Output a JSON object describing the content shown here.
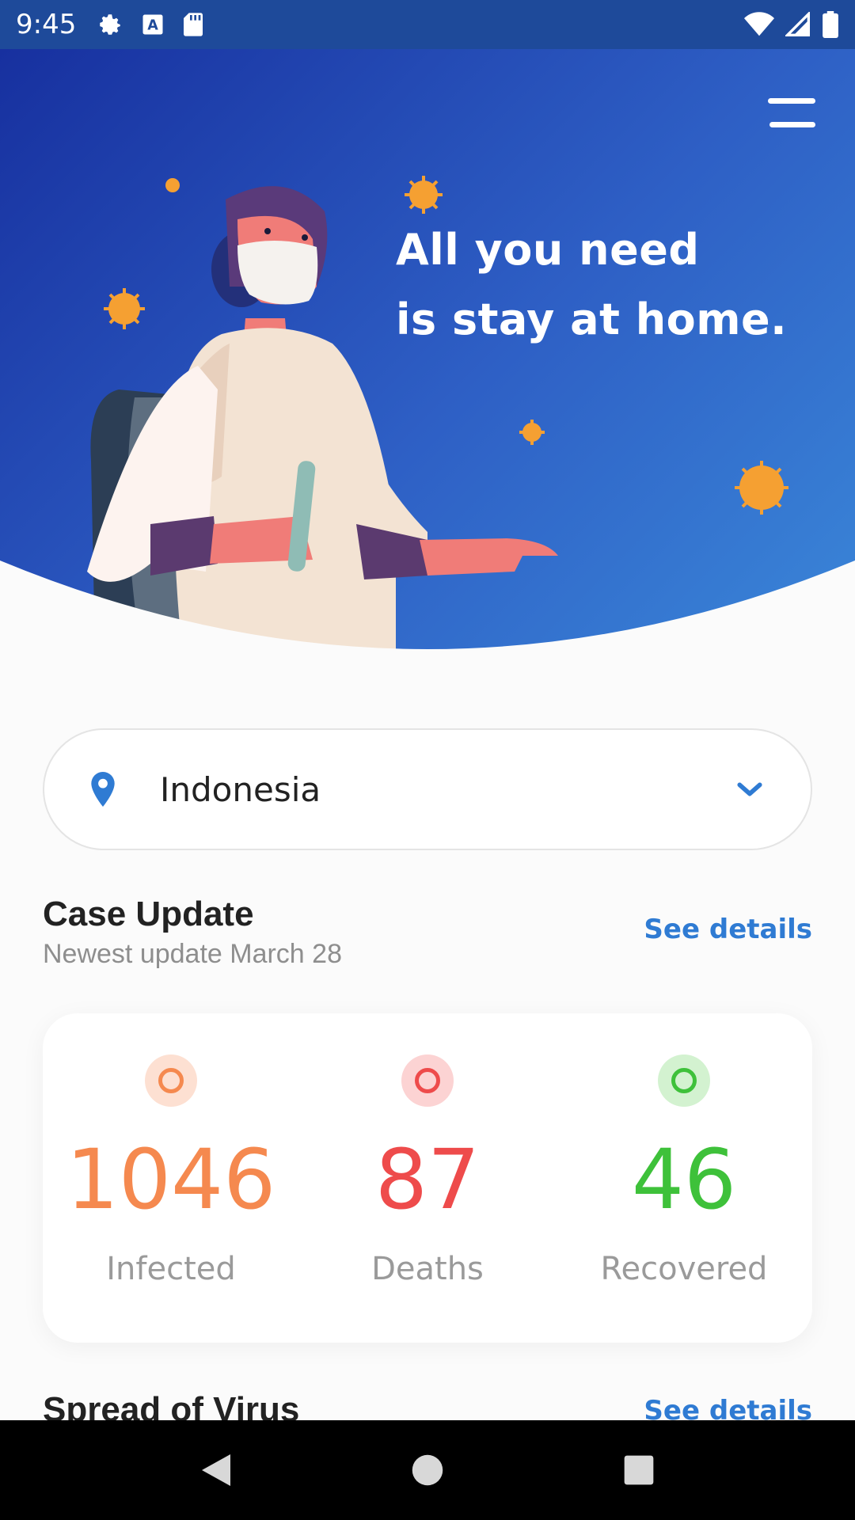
{
  "status_bar": {
    "time": "9:45",
    "left_icons": [
      "gear-icon",
      "text-a-icon",
      "sd-card-icon"
    ],
    "right_icons": [
      "wifi-icon",
      "signal-icon",
      "battery-icon"
    ]
  },
  "hero": {
    "title_line1": "All you need",
    "title_line2": "is stay at home.",
    "colors": {
      "gradient_start": "#17309f",
      "gradient_end": "#3a86d8"
    }
  },
  "country_select": {
    "value": "Indonesia",
    "icon": "location-pin-icon",
    "dropdown_icon": "chevron-down-icon"
  },
  "case_update": {
    "title": "Case Update",
    "subtitle": "Newest update March 28",
    "link": "See details"
  },
  "stats": [
    {
      "value": "1046",
      "label": "Infected",
      "color": "#f5894f"
    },
    {
      "value": "87",
      "label": "Deaths",
      "color": "#ee4b4b"
    },
    {
      "value": "46",
      "label": "Recovered",
      "color": "#3ec13a"
    }
  ],
  "spread": {
    "title": "Spread of Virus",
    "link": "See details"
  },
  "nav_bar": {
    "buttons": [
      "back-icon",
      "home-icon",
      "recents-icon"
    ]
  }
}
